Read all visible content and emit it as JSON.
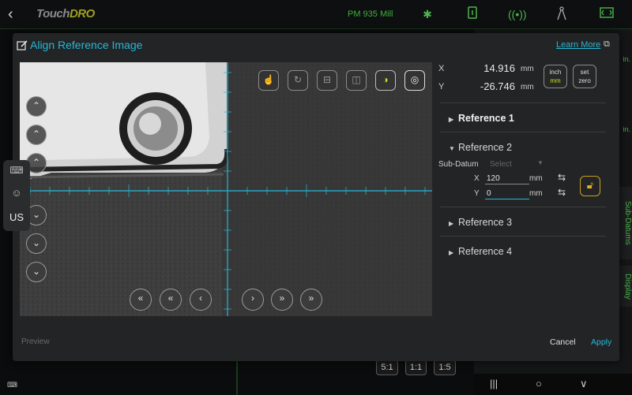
{
  "topbar": {
    "back_icon": "chevron-left-icon",
    "logo_text": "Touch",
    "logo_accent": "DRO",
    "machine_name": "PM 935 Mill",
    "icons": [
      "bluetooth-icon",
      "tablet-icon",
      "wireless-icon",
      "compass-icon",
      "screen-fit-icon"
    ]
  },
  "background": {
    "side_tabs": [
      "Sub-Datums",
      "Display"
    ],
    "zoom_buttons": [
      "5:1",
      "1:1",
      "1:5"
    ],
    "peek_text": [
      "in.",
      "in."
    ]
  },
  "modal": {
    "title": "Align Reference Image",
    "learn_more": "Learn More",
    "camera": {
      "toolbar_icons": [
        "pointer-icon",
        "rotate-icon",
        "split-horizontal-icon",
        "split-vertical-icon",
        "contrast-icon",
        "palette-icon"
      ],
      "left_controls": [
        "double-chevron-up-icon",
        "chevron-up-double-icon",
        "chevron-up-icon",
        "chevron-down-icon",
        "chevron-down-double-icon",
        "triple-chevron-down-icon"
      ],
      "bottom_controls_left": [
        "triple-chevron-left-icon",
        "double-chevron-left-icon",
        "chevron-left-icon"
      ],
      "bottom_controls_right": [
        "chevron-right-icon",
        "double-chevron-right-icon",
        "triple-chevron-right-icon"
      ]
    },
    "coords": {
      "x_label": "X",
      "x_value": "14.916",
      "x_unit": "mm",
      "y_label": "Y",
      "y_value": "-26.746",
      "y_unit": "mm",
      "unit_btn_top": "inch",
      "unit_btn_bottom": "mm",
      "set_zero_line1": "set",
      "set_zero_line2": "zero"
    },
    "references": [
      {
        "label": "Reference 1",
        "expanded": false
      },
      {
        "label": "Reference 2",
        "expanded": true
      },
      {
        "label": "Reference 3",
        "expanded": false
      },
      {
        "label": "Reference 4",
        "expanded": false
      }
    ],
    "ref2": {
      "sub_datum_label": "Sub-Datum",
      "sub_datum_placeholder": "Select",
      "x_label": "X",
      "x_value": "120",
      "x_unit": "mm",
      "y_label": "Y",
      "y_value": "0",
      "y_unit": "mm"
    },
    "footer": {
      "preview": "Preview",
      "cancel": "Cancel",
      "apply": "Apply"
    }
  },
  "keyboard_pill": {
    "language": "US",
    "icons": [
      "keyboard-icon",
      "emoji-icon"
    ]
  },
  "android_nav": [
    "recents-icon",
    "home-icon",
    "back-down-icon"
  ],
  "colors": {
    "accent": "#26b8d8",
    "green": "#4bb54b",
    "lime": "#c8e020",
    "lock": "#e0b020"
  }
}
